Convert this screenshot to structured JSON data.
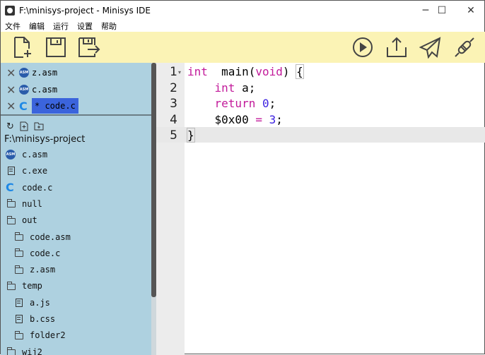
{
  "window": {
    "title": "F:\\minisys-project - Minisys IDE",
    "minimize": "─",
    "maximize": "☐",
    "close": "✕"
  },
  "menu": [
    "文件",
    "编辑",
    "运行",
    "设置",
    "帮助"
  ],
  "toolbar": {
    "left": [
      "new-file",
      "save",
      "save-as"
    ],
    "right": [
      "run",
      "upload",
      "send",
      "connect"
    ]
  },
  "tabs": [
    {
      "name": "z.asm",
      "type": "asm",
      "icon_label": "ASM"
    },
    {
      "name": "c.asm",
      "type": "asm",
      "icon_label": "ASM"
    },
    {
      "name": "* code.c",
      "type": "c",
      "icon_label": "C",
      "active": true
    }
  ],
  "tree": {
    "root": "F:\\minisys-project",
    "items": [
      {
        "name": "c.asm",
        "type": "asm",
        "depth": 0
      },
      {
        "name": "c.exe",
        "type": "file",
        "depth": 0
      },
      {
        "name": "code.c",
        "type": "c",
        "depth": 0
      },
      {
        "name": "null",
        "type": "folder",
        "depth": 0
      },
      {
        "name": "out",
        "type": "folder",
        "depth": 0
      },
      {
        "name": "code.asm",
        "type": "folder",
        "depth": 1
      },
      {
        "name": "code.c",
        "type": "folder",
        "depth": 1
      },
      {
        "name": "z.asm",
        "type": "folder",
        "depth": 1
      },
      {
        "name": "temp",
        "type": "folder",
        "depth": 0
      },
      {
        "name": "a.js",
        "type": "file",
        "depth": 1
      },
      {
        "name": "b.css",
        "type": "file",
        "depth": 1
      },
      {
        "name": "folder2",
        "type": "folder",
        "depth": 1
      },
      {
        "name": "wij2",
        "type": "folder",
        "depth": 0
      }
    ]
  },
  "editor": {
    "line_numbers": [
      "1",
      "2",
      "3",
      "4",
      "5"
    ],
    "current_line": 5,
    "lines": [
      [
        [
          "kw",
          "int"
        ],
        [
          "",
          "  main("
        ],
        [
          "kw",
          "void"
        ],
        [
          "",
          ") "
        ],
        [
          "br",
          "{"
        ]
      ],
      [
        [
          "",
          "    "
        ],
        [
          "kw",
          "int"
        ],
        [
          "",
          " a;"
        ]
      ],
      [
        [
          "",
          "    "
        ],
        [
          "kw",
          "return"
        ],
        [
          "",
          " "
        ],
        [
          "num",
          "0"
        ],
        [
          "",
          ";"
        ]
      ],
      [
        [
          "",
          "    $0x00 "
        ],
        [
          "kw",
          "="
        ],
        [
          "",
          " "
        ],
        [
          "num",
          "3"
        ],
        [
          "",
          ";"
        ]
      ],
      [
        [
          "br",
          "}"
        ]
      ]
    ]
  },
  "colors": {
    "toolbar": "#fbf3b5",
    "sidebar": "#aed1e0",
    "active_tab": "#3b64dc",
    "keyword": "#c21a9a",
    "number": "#3a1fe0"
  }
}
